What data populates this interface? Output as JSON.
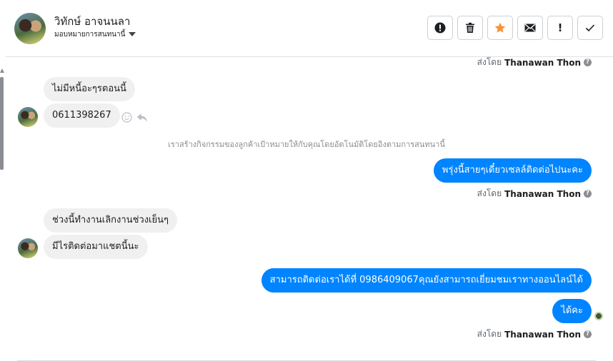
{
  "header": {
    "contact_name": "วิทักษ์ อาจนนลา",
    "assign_label": "มอบหมายการสนทนานี้",
    "toolbar": [
      "alert-icon",
      "trash-icon",
      "star-icon",
      "mail-icon",
      "exclamation-icon",
      "check-icon"
    ],
    "exclamation_text": "!"
  },
  "messages": {
    "sent_by_prefix": "ส่งโดย",
    "sent_by_name": "Thanawan Thon",
    "info_icon": "?",
    "in1": "ไม่มีหนี้อะๆรตอนนี้",
    "in2": "0611398267",
    "system": "เราสร้างกิจกรรมของลูกค้าเป้าหมายให้กับคุณโดยอัตโนมัติโดยอิงตามการสนทนานี้",
    "out1": "พรุ่งนี้สายๆเดี๋ยวเซลล์ติดต่อไปนะคะ",
    "in3": "ช่วงนี้ทำงานเลิกงานช่วงเย็นๆ",
    "in4": "มีไรติดต่อมาแชตนี้นะ",
    "out2": "สามารถติดต่อเราได้ที่ 0986409067คุณยังสามารถเยี่ยมชมเราทางออนไลน์ได้",
    "out3": "ได้คะ"
  },
  "colors": {
    "outgoing_bubble": "#0084ff",
    "incoming_bubble": "#f0f0f0",
    "star_accent": "#f7923a"
  }
}
